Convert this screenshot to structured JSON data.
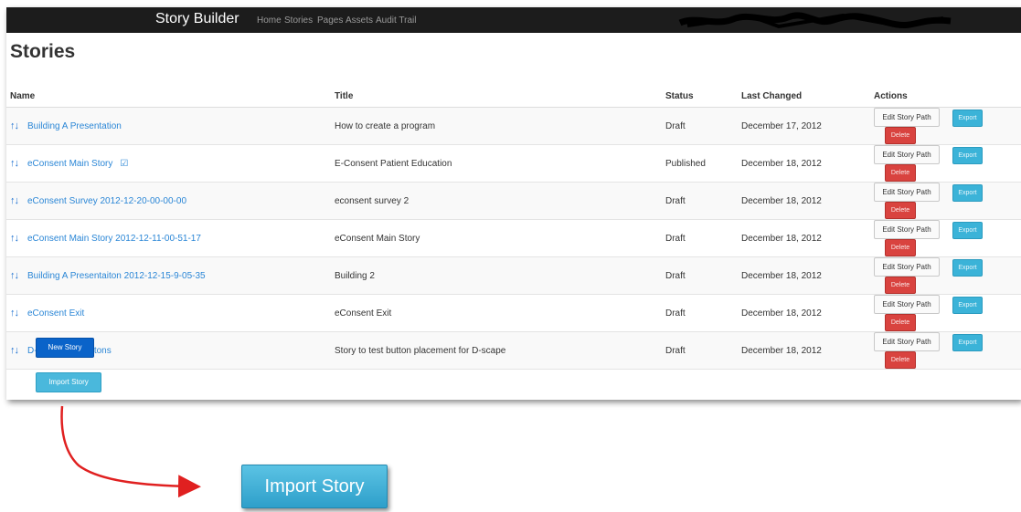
{
  "app": {
    "brand": "Story Builder",
    "nav": [
      "Home",
      "Stories",
      "Pages",
      "Assets",
      "Audit Trail"
    ]
  },
  "page": {
    "title": "Stories"
  },
  "table": {
    "headers": {
      "name": "Name",
      "title": "Title",
      "status": "Status",
      "changed": "Last Changed",
      "actions": "Actions"
    },
    "rows": [
      {
        "name": "Building A Presentation",
        "title": "How to create a program",
        "status": "Draft",
        "changed": "December 17, 2012"
      },
      {
        "name": "eConsent Main Story",
        "title": "E-Consent Patient Education",
        "status": "Published",
        "changed": "December 18, 2012"
      },
      {
        "name": "eConsent Survey 2012-12-20-00-00-00",
        "title": "econsent survey 2",
        "status": "Draft",
        "changed": "December 18, 2012"
      },
      {
        "name": "eConsent Main Story 2012-12-11-00-51-17",
        "title": "eConsent Main Story",
        "status": "Draft",
        "changed": "December 18, 2012"
      },
      {
        "name": "Building A Presentaiton 2012-12-15-9-05-35",
        "title": "Building 2",
        "status": "Draft",
        "changed": "December 18, 2012"
      },
      {
        "name": "eConsent Exit",
        "title": "eConsent Exit",
        "status": "Draft",
        "changed": "December 18, 2012"
      },
      {
        "name": "D-scape test buttons",
        "title": "Story to test button placement for D-scape",
        "status": "Draft",
        "changed": "December 18, 2012"
      }
    ],
    "actions": {
      "edit": "Edit Story Path",
      "export": "Export",
      "delete": "Delete"
    },
    "reorder_glyph": "↑↓",
    "published_icon": "check-square-icon"
  },
  "buttons": {
    "new_story": "New Story",
    "import_story": "Import Story"
  },
  "callout": {
    "import_story": "Import Story",
    "arrow_color": "#e02020"
  },
  "colors": {
    "navbar": "#1c1c1c",
    "link": "#2a86d6",
    "primary": "#0a63c9",
    "info": "#3bb3d8",
    "danger": "#d9433f"
  }
}
